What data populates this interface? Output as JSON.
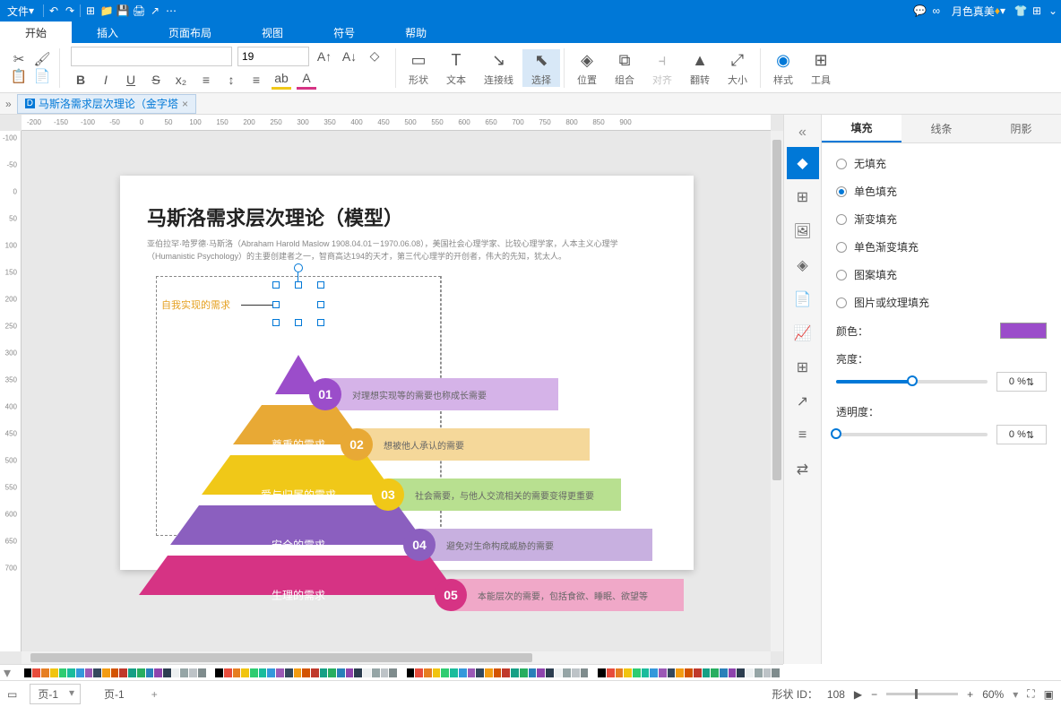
{
  "menu": {
    "file": "文件",
    "user": "月色真美"
  },
  "ribbon_tabs": [
    "开始",
    "插入",
    "页面布局",
    "视图",
    "符号",
    "帮助"
  ],
  "active_ribbon": 0,
  "font": {
    "size": "19"
  },
  "tools": {
    "shape": "形状",
    "text": "文本",
    "connector": "连接线",
    "select": "选择",
    "position": "位置",
    "group": "组合",
    "align": "对齐",
    "flip": "翻转",
    "size": "大小",
    "style": "样式",
    "tool": "工具"
  },
  "doc_tab": "马斯洛需求层次理论（金字塔",
  "page": {
    "title": "马斯洛需求层次理论（模型）",
    "desc1": "亚伯拉罕·哈罗德·马斯洛（Abraham Harold Maslow 1908.04.01－1970.06.08），美国社会心理学家、比较心理学家，人本主义心理学",
    "desc2": "（Humanistic Psychology）的主要创建者之一，智商高达194的天才，第三代心理学的开创者，伟大的先知，犹太人。",
    "selected_label": "自我实现的需求",
    "rows": [
      {
        "label": "",
        "num": "01",
        "bar": "对理想实现等的需要也称成长需要",
        "trap_color": "#9b4dca",
        "num_color": "#9b4dca",
        "bar_color": "#d5b3e8"
      },
      {
        "label": "尊重的需求",
        "num": "02",
        "bar": "想被他人承认的需要",
        "trap_color": "#e8a935",
        "num_color": "#e8a935",
        "bar_color": "#f5d89a"
      },
      {
        "label": "爱与归属的需求",
        "num": "03",
        "bar": "社会需要，与他人交流相关的需要变得更重要",
        "trap_color": "#f0c818",
        "num_color": "#f0c818",
        "bar_color": "#b8e090"
      },
      {
        "label": "安全的需求",
        "num": "04",
        "bar": "避免对生命构成威胁的需要",
        "trap_color": "#8b5fbf",
        "num_color": "#8b5fbf",
        "bar_color": "#c8b0e0"
      },
      {
        "label": "生理的需求",
        "num": "05",
        "bar": "本能层次的需要，包括食欲、睡眠、欲望等",
        "trap_color": "#d63384",
        "num_color": "#d63384",
        "bar_color": "#f0a8c8"
      }
    ]
  },
  "right_panel": {
    "tabs": [
      "填充",
      "线条",
      "阴影"
    ],
    "active": 0,
    "fill_opts": [
      "无填充",
      "单色填充",
      "渐变填充",
      "单色渐变填充",
      "图案填充",
      "图片或纹理填充"
    ],
    "fill_sel": 1,
    "color_label": "颜色：",
    "brightness_label": "亮度：",
    "brightness_val": "0 %",
    "opacity_label": "透明度：",
    "opacity_val": "0 %"
  },
  "status": {
    "page_sel": "页-1",
    "page_txt": "页-1",
    "shape_id_label": "形状 ID：",
    "shape_id": "108",
    "zoom": "60%"
  },
  "colors": [
    "#fff",
    "#000",
    "#e74c3c",
    "#e67e22",
    "#f1c40f",
    "#2ecc71",
    "#1abc9c",
    "#3498db",
    "#9b59b6",
    "#34495e",
    "#f39c12",
    "#d35400",
    "#c0392b",
    "#16a085",
    "#27ae60",
    "#2980b9",
    "#8e44ad",
    "#2c3e50",
    "#ecf0f1",
    "#95a5a6",
    "#bdc3c7",
    "#7f8c8d"
  ]
}
